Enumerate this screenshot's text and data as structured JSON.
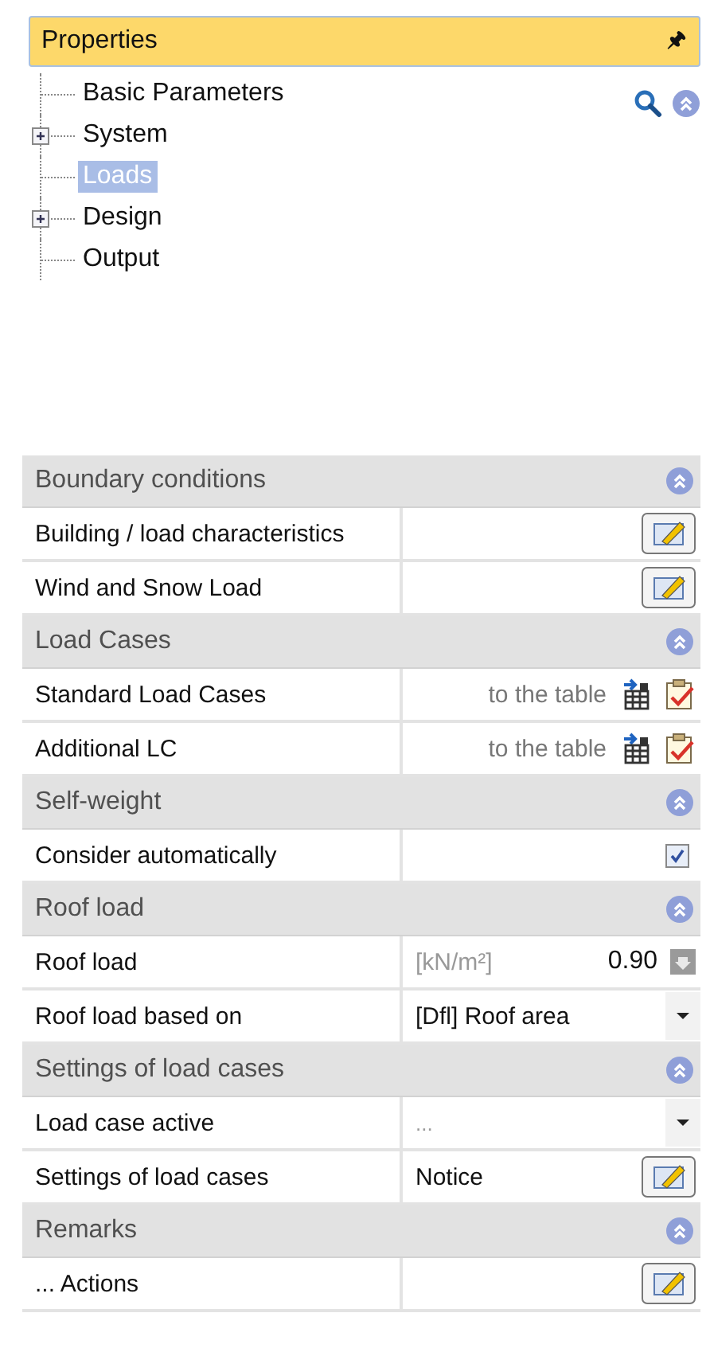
{
  "panel": {
    "title": "Properties",
    "pin": "🖈"
  },
  "tree": [
    {
      "label": "Basic Parameters",
      "kind": "leaf",
      "selected": false
    },
    {
      "label": "System",
      "kind": "folder",
      "expanded": false,
      "selected": false
    },
    {
      "label": "Loads",
      "kind": "leaf",
      "selected": true
    },
    {
      "label": "Design",
      "kind": "folder",
      "expanded": false,
      "selected": false
    },
    {
      "label": "Output",
      "kind": "leaf",
      "selected": false
    }
  ],
  "sections": [
    {
      "title": "Boundary conditions",
      "expanded": true,
      "rows": [
        {
          "label": "Building / load characteristics",
          "kind": "edit"
        },
        {
          "label": "Wind and Snow Load",
          "kind": "edit"
        }
      ]
    },
    {
      "title": "Load Cases",
      "expanded": true,
      "rows": [
        {
          "label": "Standard Load Cases",
          "kind": "table",
          "value": "to the table"
        },
        {
          "label": "Additional LC",
          "kind": "table",
          "value": "to the table"
        }
      ]
    },
    {
      "title": "Self-weight",
      "expanded": true,
      "rows": [
        {
          "label": "Consider automatically",
          "kind": "check",
          "checked": true
        }
      ]
    },
    {
      "title": "Roof load",
      "expanded": true,
      "rows": [
        {
          "label": "Roof load",
          "kind": "number",
          "unit": "[kN/m²]",
          "value": "0.90"
        },
        {
          "label": "Roof load based on",
          "kind": "dropdown",
          "value": "[Dfl] Roof area"
        }
      ]
    },
    {
      "title": "Settings of load cases",
      "expanded": true,
      "rows": [
        {
          "label": "Load case active",
          "kind": "dropdown",
          "placeholder": "..."
        },
        {
          "label": "Settings of load cases",
          "kind": "edit",
          "value": "Notice"
        }
      ]
    },
    {
      "title": "Remarks",
      "expanded": true,
      "rows": [
        {
          "label": "... Actions",
          "kind": "edit"
        }
      ]
    }
  ]
}
